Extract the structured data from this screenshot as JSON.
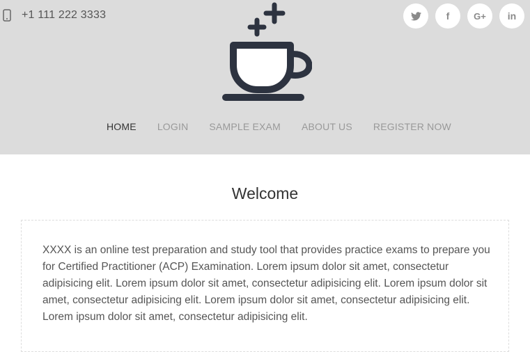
{
  "header": {
    "phone": "+1 111 222 3333",
    "phone_icon": "mobile-phone-icon",
    "logo_icon": "coffee-cup-logo-icon",
    "social": [
      {
        "name": "twitter",
        "glyph": "🐦",
        "icon": "twitter-icon"
      },
      {
        "name": "facebook",
        "glyph": "f",
        "icon": "facebook-icon"
      },
      {
        "name": "google-plus",
        "glyph": "G+",
        "icon": "google-plus-icon"
      },
      {
        "name": "linkedin",
        "glyph": "in",
        "icon": "linkedin-icon"
      }
    ]
  },
  "nav": {
    "items": [
      "HOME",
      "LOGIN",
      "SAMPLE EXAM",
      "ABOUT US",
      "REGISTER NOW"
    ],
    "active": "HOME"
  },
  "main": {
    "title": "Welcome",
    "description": "XXXX is an online test preparation and study tool that provides practice exams to prepare you for Certified Practitioner (ACP) Examination. Lorem ipsum dolor sit amet, consectetur adipisicing elit. Lorem ipsum dolor sit amet, consectetur adipisicing elit. Lorem ipsum dolor sit amet, consectetur adipisicing elit. Lorem ipsum dolor sit amet, consectetur adipisicing elit. Lorem ipsum dolor sit amet, consectetur adipisicing elit."
  },
  "colors": {
    "header_bg": "#dcdcdc",
    "logo": "#2d3340",
    "nav_active": "#333333",
    "nav_inactive": "#999999"
  }
}
